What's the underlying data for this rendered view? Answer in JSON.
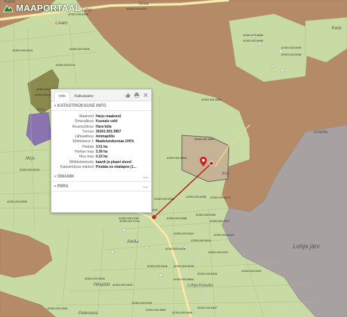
{
  "app": {
    "logo_text": "MAAPORTAAL"
  },
  "map": {
    "place_labels": [
      "Kopra",
      "Nõva",
      "Lohja",
      "Livako",
      "Karja",
      "Mirja",
      "Altolla",
      "Lohja-Kasuku",
      "Pikapõld",
      "Palanseva",
      "Ametlla",
      "Kinn",
      "Kris"
    ],
    "lake_label": "Lohja järv",
    "parcel_labels": [
      "42301:002:0920",
      "42301:002:0920",
      "42301:002:0923",
      "42301:002:0888",
      "42301:002:0890",
      "42301:002:0005",
      "42301:002:0006",
      "42301:001:0863",
      "42301:002:0216",
      "42301:002:0112",
      "42301:002:0305",
      "42301:002:0123",
      "42301:002:0122",
      "42301:002:0325",
      "42301:002:0331",
      "42301:002:0308",
      "42301:002:0307",
      "42301:002:0433",
      "42301:002:0855",
      "42301:001:0856",
      "42301:002:0383",
      "42301:002:0385",
      "42301:002:0414",
      "42301:002:0381",
      "42301:002:0388",
      "35301:001:0857",
      "42301:002:0307",
      "42301:002:0424",
      "42301:002:0423",
      "42301:001:0004",
      "42301:002:0335",
      "42301:001:0765",
      "42301:001:0764",
      "42301:002:0428",
      "42301:002:0437",
      "42301:002:0438",
      "42301:002:0448",
      "42301:002:0453",
      "42301:002:0463",
      "42301:002:0394",
      "42301:002:0306",
      "42301:002:0864",
      "42301:002:0355",
      "42301:001:0864",
      "42301:002:0486",
      "42301:002:0487",
      "42301:002:0457"
    ]
  },
  "popup": {
    "tabs": [
      "Info",
      "Kalkulaator"
    ],
    "active_tab": "Info",
    "sections": {
      "katastri_title": "KATASTRIÜKSUSE INFO",
      "omanik_title": "OMANIK",
      "omanik_action": "Ava",
      "piira_title": "PIIRA",
      "piira_action": "Ava"
    },
    "rows": [
      {
        "key": "Maakond",
        "value": "Harju maakond"
      },
      {
        "key": "Omavalitsus",
        "value": "Kuusalu vald"
      },
      {
        "key": "Asustusüksus",
        "value": "Hara küla"
      },
      {
        "key": "Tunnus",
        "value": "35301:001:0857"
      },
      {
        "key": "Lähiaadress",
        "value": "Ämmapõllu"
      },
      {
        "key": "Sihtotstarve 1",
        "value": "Maatulundusmaa 100%"
      },
      {
        "key": "Pindala",
        "value": "3.51 ha"
      },
      {
        "key": "Haritav maa",
        "value": "3.36 ha"
      },
      {
        "key": "Muu maa",
        "value": "0.15 ha"
      },
      {
        "key": "Mõõdistamisviis",
        "value": "kaardi ja plaani alusel"
      },
      {
        "key": "Katastriüksus märked",
        "value": "Pindala on ebatäpne (1..."
      }
    ]
  },
  "colors": {
    "field": "#c9dba4",
    "forest": "#b58a66",
    "lake": "#a7a2a1",
    "selected_parcel": "#c6b396",
    "marker": "#d32020",
    "bog": "#8b8a4e",
    "purple_area": "#8a75b0"
  }
}
